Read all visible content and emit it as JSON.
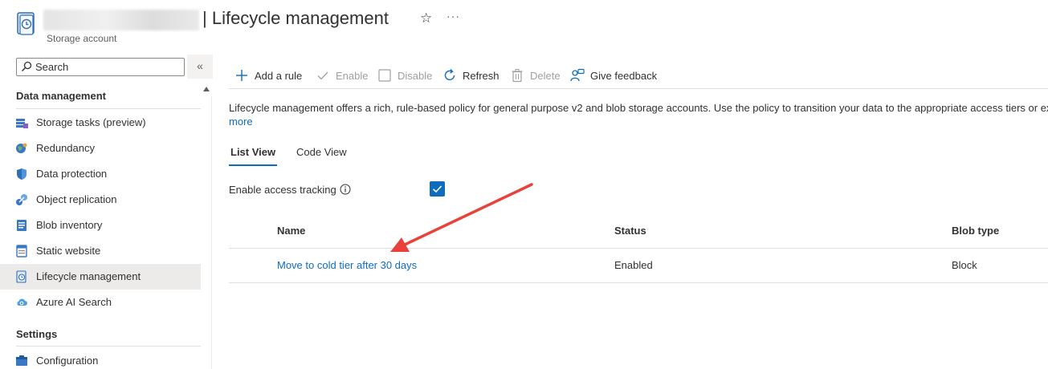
{
  "header": {
    "title": "| Lifecycle management",
    "subtitle": "Storage account"
  },
  "sidebar": {
    "search_placeholder": "Search",
    "collapse_glyph": "«",
    "sections": [
      {
        "header": "Data management",
        "items": [
          {
            "label": "Storage tasks (preview)",
            "icon": "storage-tasks-icon"
          },
          {
            "label": "Redundancy",
            "icon": "globe-icon"
          },
          {
            "label": "Data protection",
            "icon": "shield-icon"
          },
          {
            "label": "Object replication",
            "icon": "replication-icon"
          },
          {
            "label": "Blob inventory",
            "icon": "inventory-icon"
          },
          {
            "label": "Static website",
            "icon": "website-icon"
          },
          {
            "label": "Lifecycle management",
            "icon": "lifecycle-icon",
            "selected": true
          },
          {
            "label": "Azure AI Search",
            "icon": "cloud-search-icon"
          }
        ]
      },
      {
        "header": "Settings",
        "items": [
          {
            "label": "Configuration",
            "icon": "configuration-icon"
          }
        ]
      }
    ]
  },
  "toolbar": {
    "add_rule": "Add a rule",
    "enable": "Enable",
    "disable": "Disable",
    "refresh": "Refresh",
    "delete": "Delete",
    "feedback": "Give feedback"
  },
  "main": {
    "description": "Lifecycle management offers a rich, rule-based policy for general purpose v2 and blob storage accounts. Use the policy to transition your data to the appropriate access tiers or ex",
    "more_link": "more",
    "tabs": [
      {
        "label": "List View",
        "active": true
      },
      {
        "label": "Code View",
        "active": false
      }
    ],
    "access_tracking": {
      "label": "Enable access tracking",
      "checked": true
    },
    "table": {
      "columns": [
        "Name",
        "Status",
        "Blob type"
      ],
      "rows": [
        [
          "Move to cold tier after 30 days",
          "Enabled",
          "Block"
        ]
      ]
    }
  },
  "colors": {
    "accent": "#0f6cbd",
    "annotation_arrow": "#e8423b",
    "selected_nav": "#edebe9"
  }
}
